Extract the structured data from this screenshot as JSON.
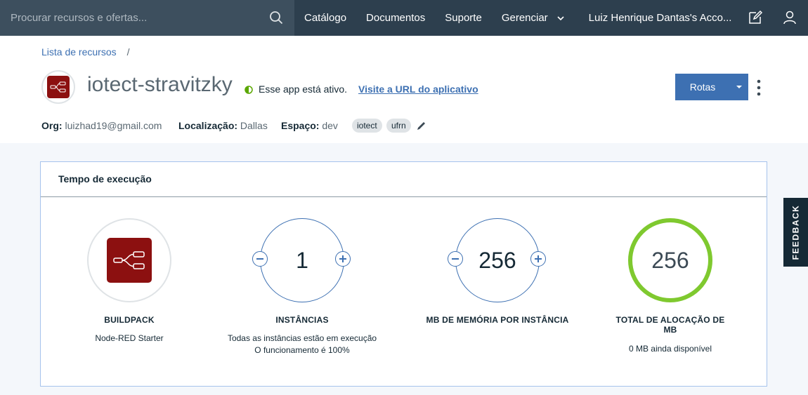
{
  "nav": {
    "search_placeholder": "Procurar recursos e ofertas...",
    "links": [
      "Catálogo",
      "Documentos",
      "Suporte",
      "Gerenciar"
    ],
    "account": "Luiz Henrique Dantas's Acco...",
    "icons": [
      "search-icon",
      "chevron-down-icon",
      "edit-icon",
      "user-icon"
    ]
  },
  "header": {
    "breadcrumb": "Lista de recursos",
    "breadcrumb_sep": "/",
    "app_name": "iotect-stravitzky",
    "status_text": "Esse app está ativo.",
    "visit_link": "Visite a URL do aplicativo",
    "routes_button": "Rotas",
    "org_label": "Org:",
    "org_value": "luizhad19@gmail.com",
    "location_label": "Localização:",
    "location_value": "Dallas",
    "space_label": "Espaço:",
    "space_value": "dev",
    "tags": [
      "iotect",
      "ufrn"
    ]
  },
  "runtime": {
    "title": "Tempo de execução",
    "buildpack": {
      "label": "BUILDPACK",
      "value": "Node-RED Starter"
    },
    "instances": {
      "value": "1",
      "label": "INSTÂNCIAS",
      "line1": "Todas as instâncias estão em execução",
      "line2": "O funcionamento é 100%"
    },
    "memory": {
      "value": "256",
      "label": "MB DE MEMÓRIA POR INSTÂNCIA"
    },
    "total": {
      "value": "256",
      "label": "TOTAL DE ALOCAÇÃO DE MB",
      "sub": "0 MB ainda disponível"
    }
  },
  "feedback": "FEEDBACK",
  "colors": {
    "nav_bg": "#2d3f4e",
    "accent": "#3d70b2",
    "status_green": "#7fc92f",
    "brand_red": "#8c1010"
  }
}
